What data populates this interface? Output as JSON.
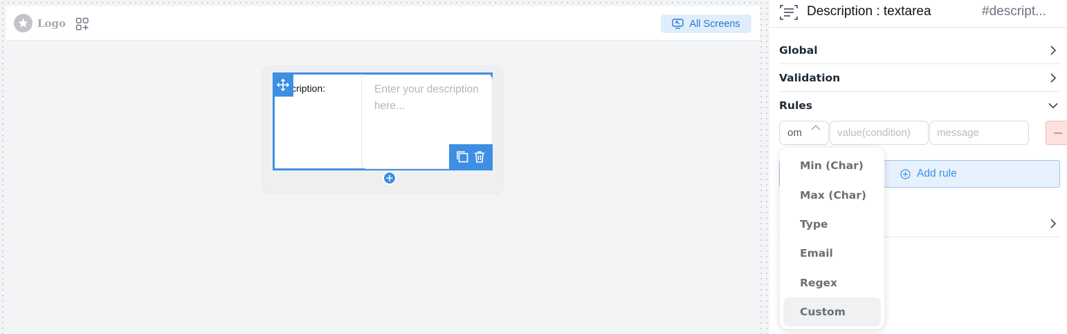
{
  "topbar": {
    "logo_text": "Logo",
    "all_screens_label": "All Screens"
  },
  "canvas": {
    "field_label": "cription:",
    "textarea_placeholder": "Enter your description here..."
  },
  "panel": {
    "title": "Description : textarea",
    "element_id": "#descript...",
    "sections": [
      {
        "label": "Global"
      },
      {
        "label": "Validation"
      },
      {
        "label": "Rules"
      }
    ],
    "rule": {
      "type_value": "om",
      "value_placeholder": "value(condition)",
      "message_placeholder": "message",
      "remove_label": "—"
    },
    "add_rule_label": "Add rule"
  },
  "rule_type_dropdown": {
    "options": [
      "Min (Char)",
      "Max (Char)",
      "Type",
      "Email",
      "Regex",
      "Custom"
    ],
    "highlighted": "Custom"
  },
  "colors": {
    "accent": "#3d8fe3",
    "remove_bg": "#fde2e2"
  }
}
